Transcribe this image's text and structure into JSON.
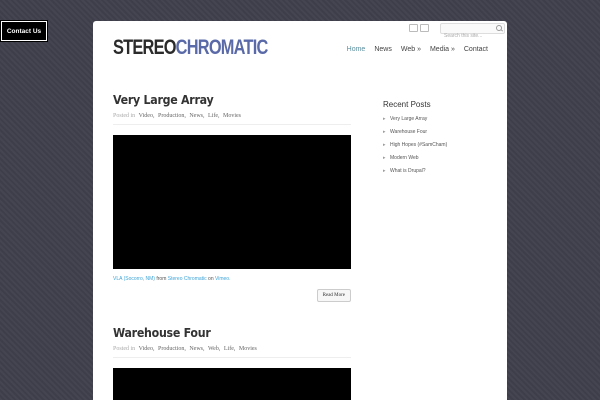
{
  "contact_tab": {
    "label": "Contact Us"
  },
  "header": {
    "logo": {
      "part1": "STEREO",
      "part2": "CHROMATIC"
    },
    "search": {
      "placeholder": "Search this site..."
    },
    "nav": [
      "Home",
      "News",
      "Web »",
      "Media »",
      "Contact"
    ],
    "active_nav_index": 0
  },
  "posts": [
    {
      "title": "Very Large Array",
      "posted_in": "Posted in",
      "categories": [
        "Video,",
        "Production,",
        "News,",
        "Life,",
        "Movies"
      ],
      "caption": {
        "link1": "VLA (Socorro, NM)",
        "from": "from",
        "link2": "Stereo Chromatic",
        "on": "on",
        "link3": "Vimeo."
      },
      "read_more": "Read More"
    },
    {
      "title": "Warehouse Four",
      "posted_in": "Posted in",
      "categories": [
        "Video,",
        "Production,",
        "News,",
        "Web,",
        "Life,",
        "Movies"
      ]
    }
  ],
  "sidebar": {
    "title": "Recent Posts",
    "items": [
      "Very Large Array",
      "Warehouse Four",
      "High Hopes (#SamCham)",
      "Modern Web",
      "What is Drupal?"
    ]
  },
  "colors": {
    "background": "#3d3e4a",
    "logo_accent": "#5a6aa8",
    "link": "#3ea4d8",
    "nav_active": "#5a8f9f"
  }
}
